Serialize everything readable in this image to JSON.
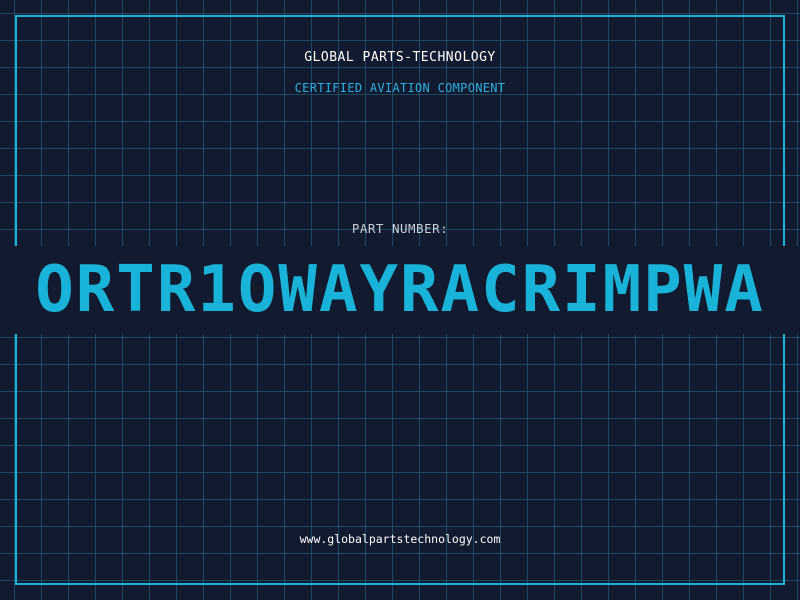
{
  "header": {
    "company": "GLOBAL PARTS-TECHNOLOGY",
    "subtitle": "CERTIFIED AVIATION COMPONENT"
  },
  "part": {
    "label": "PART NUMBER:",
    "number": "ORTR1OWAYRACRIMPWA"
  },
  "footer": {
    "website": "www.globalpartstechnology.com"
  },
  "colors": {
    "background": "#111a2e",
    "grid": "#286e8c",
    "accent": "#19b3d9",
    "text": "#ffffff"
  }
}
